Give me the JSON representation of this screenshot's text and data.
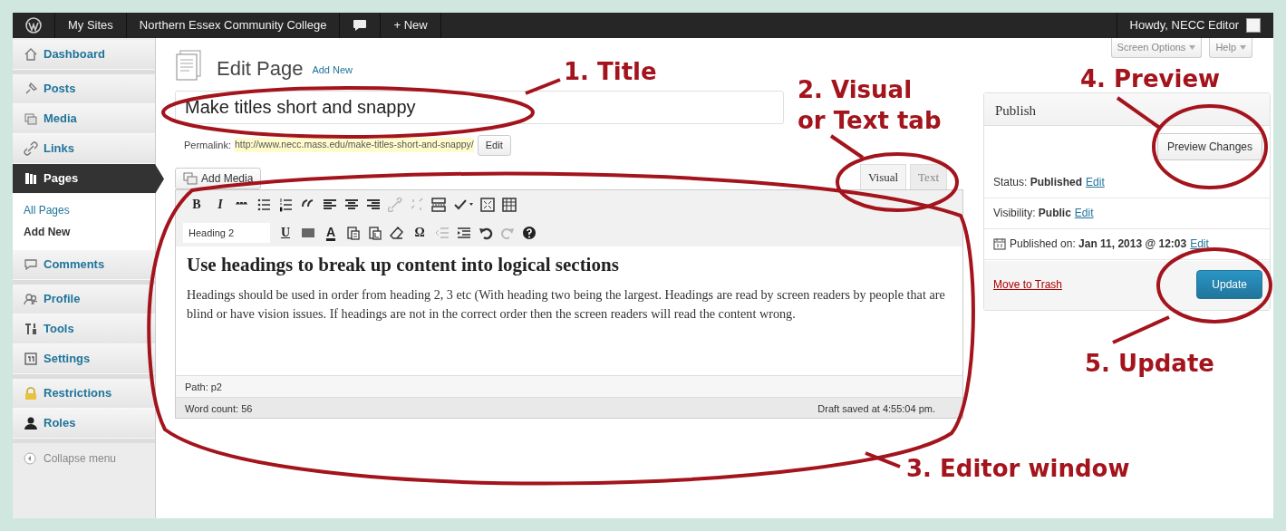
{
  "admin_bar": {
    "items": [
      "My Sites",
      "Northern Essex Community College",
      "+ New"
    ],
    "account": "Howdy, NECC Editor"
  },
  "sidebar": {
    "groups": [
      [
        {
          "label": "Dashboard",
          "selected": false
        }
      ],
      [
        {
          "label": "Posts",
          "selected": false
        },
        {
          "label": "Media",
          "selected": false
        },
        {
          "label": "Links",
          "selected": false
        },
        {
          "label": "Pages",
          "selected": true,
          "children": [
            {
              "label": "All Pages",
              "selected": false
            },
            {
              "label": "Add New",
              "selected": true
            }
          ]
        },
        {
          "label": "Comments",
          "selected": false
        }
      ],
      [
        {
          "label": "Profile",
          "selected": false
        },
        {
          "label": "Tools",
          "selected": false
        },
        {
          "label": "Settings",
          "selected": false
        }
      ],
      [
        {
          "label": "Restrictions",
          "selected": false
        },
        {
          "label": "Roles",
          "selected": false
        }
      ]
    ],
    "collapse": "Collapse menu"
  },
  "screen_meta": [
    "Screen Options",
    "Help"
  ],
  "heading": {
    "title": "Edit Page",
    "add_new": "Add New"
  },
  "post_title": "Make titles short and snappy",
  "permalink": {
    "label": "Permalink:",
    "url": "http://www.necc.mass.edu/make-titles-short-and-snappy/",
    "edit": "Edit"
  },
  "add_media": "Add Media",
  "editor_tabs": [
    {
      "label": "Visual",
      "selected": true
    },
    {
      "label": "Text",
      "selected": false
    }
  ],
  "toolbar": [
    [
      {
        "kind": "glyph",
        "label": "B",
        "disabled": false
      },
      {
        "kind": "glyph",
        "label": "I",
        "disabled": false
      },
      {
        "kind": "icon",
        "disabled": false
      },
      {
        "kind": "icon",
        "disabled": false
      },
      {
        "kind": "icon",
        "disabled": false
      },
      {
        "kind": "icon",
        "disabled": false
      },
      {
        "kind": "icon",
        "disabled": false
      },
      {
        "kind": "icon",
        "disabled": false
      },
      {
        "kind": "icon",
        "disabled": false
      },
      {
        "kind": "icon",
        "disabled": true
      },
      {
        "kind": "icon",
        "disabled": true
      },
      {
        "kind": "icon",
        "disabled": false
      },
      {
        "kind": "icon",
        "disabled": false
      },
      {
        "kind": "icon",
        "disabled": false
      },
      {
        "kind": "icon",
        "disabled": false
      }
    ],
    [
      {
        "kind": "select",
        "label": "Heading 2",
        "disabled": false
      },
      {
        "kind": "glyph",
        "label": "U",
        "disabled": false
      },
      {
        "kind": "icon",
        "disabled": false
      },
      {
        "kind": "glyph",
        "label": "A",
        "disabled": false
      },
      {
        "kind": "icon",
        "disabled": false
      },
      {
        "kind": "icon",
        "disabled": false
      },
      {
        "kind": "icon",
        "disabled": false
      },
      {
        "kind": "glyph",
        "label": "Ω",
        "disabled": false
      },
      {
        "kind": "icon",
        "disabled": true
      },
      {
        "kind": "icon",
        "disabled": false
      },
      {
        "kind": "icon",
        "disabled": false
      },
      {
        "kind": "icon",
        "disabled": true
      },
      {
        "kind": "icon",
        "disabled": false
      }
    ]
  ],
  "content": {
    "heading": "Use headings to break up content into logical sections",
    "paragraph": "Headings should be used in order from heading 2, 3 etc (With heading two being the largest. Headings are read by screen readers by people that are blind or have vision issues. If headings are not in the correct order then the screen readers will read the content wrong."
  },
  "path": "Path: p2",
  "word_count": "Word count: 56",
  "draft_saved": "Draft saved at 4:55:04 pm.",
  "publish": {
    "title": "Publish",
    "preview": "Preview Changes",
    "rows": [
      {
        "text": "Status: **Published**",
        "edit": "Edit"
      },
      {
        "text": "Visibility: **Public**",
        "edit": "Edit"
      },
      {
        "text": "Published on: **Jan 11, 2013 @ 12:03**",
        "edit": "Edit"
      }
    ],
    "trash": "Move to Trash",
    "update": "Update"
  },
  "annotations": [
    {
      "lines": [
        "1. Title"
      ]
    },
    {
      "lines": [
        "2. Visual",
        "or Text tab"
      ]
    },
    {
      "lines": [
        "3. Editor window"
      ]
    },
    {
      "lines": [
        "4. Preview"
      ]
    },
    {
      "lines": [
        "5. Update"
      ]
    }
  ]
}
